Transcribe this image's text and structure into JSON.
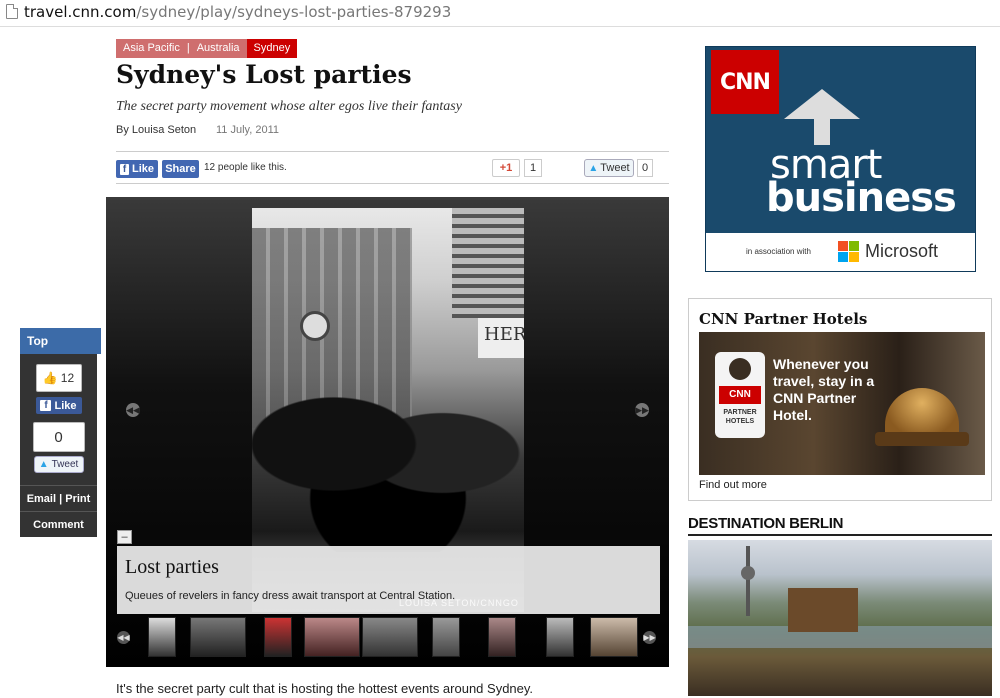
{
  "browser": {
    "url_host": "travel.cnn.com",
    "url_path": "/sydney/play/sydneys-lost-parties-879293"
  },
  "breadcrumb": {
    "items": [
      "Asia Pacific",
      "Australia",
      "Sydney"
    ],
    "separator": "|"
  },
  "article": {
    "title": "Sydney's Lost parties",
    "subtitle": "The secret party movement whose alter egos live their fantasy",
    "byline": "By Louisa Seton",
    "date": "11 July, 2011",
    "first_line": "It's the secret party cult that is hosting the hottest events around Sydney."
  },
  "social": {
    "like_label": "Like",
    "share_label": "Share",
    "likes_text": "12 people like this.",
    "gplus_label": "+1",
    "gplus_count": "1",
    "tweet_label": "Tweet",
    "tweet_count": "0"
  },
  "sharebar": {
    "top_label": "Top",
    "like_count": "12",
    "like_label": "Like",
    "tweet_count": "0",
    "tweet_label": "Tweet",
    "email_label": "Email",
    "print_label": "Print",
    "comment_label": "Comment"
  },
  "gallery": {
    "caption_title": "Lost parties",
    "caption_text": "Queues of revelers in fancy dress await transport at Central Station.",
    "photo_credit": "LOUISA SETON/CNNGO",
    "sign_text": "HER",
    "thumbnail_count": 10
  },
  "ads": {
    "cnn_logo": "CNN",
    "smart": "smart",
    "business": "business",
    "association": "in association with",
    "microsoft": "Microsoft"
  },
  "hotels": {
    "title": "CNN Partner Hotels",
    "card_logo": "CNN",
    "card_text": "PARTNER HOTELS",
    "ad_copy": "Whenever you travel, stay in a CNN Partner Hotel.",
    "link": "Find out more"
  },
  "berlin": {
    "title": "DESTINATION BERLIN"
  },
  "colors": {
    "facebook": "#3b5998",
    "cnn_red": "#cc0000",
    "tag_active": "#cc0000",
    "tag": "#cf6e6e",
    "ad_blue": "#1a4a6c"
  }
}
